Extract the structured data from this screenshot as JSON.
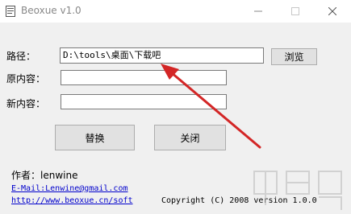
{
  "window": {
    "title": "Beoxue v1.0"
  },
  "form": {
    "path_label": "路径：",
    "path_value": "D:\\tools\\桌面\\下载吧",
    "browse_label": "浏览",
    "original_label": "原内容：",
    "original_value": "",
    "new_label": "新内容：",
    "new_value": ""
  },
  "actions": {
    "replace_label": "替换",
    "close_label": "关闭"
  },
  "footer": {
    "author": "作者：lenwine",
    "email": "E-Mail:Lenwine@gmail.com",
    "website": "http://www.beoxue.cn/soft",
    "copyright": "Copyright (C) 2008 version 1.0.0"
  },
  "colors": {
    "arrow": "#d32626",
    "link": "#0000cc"
  }
}
